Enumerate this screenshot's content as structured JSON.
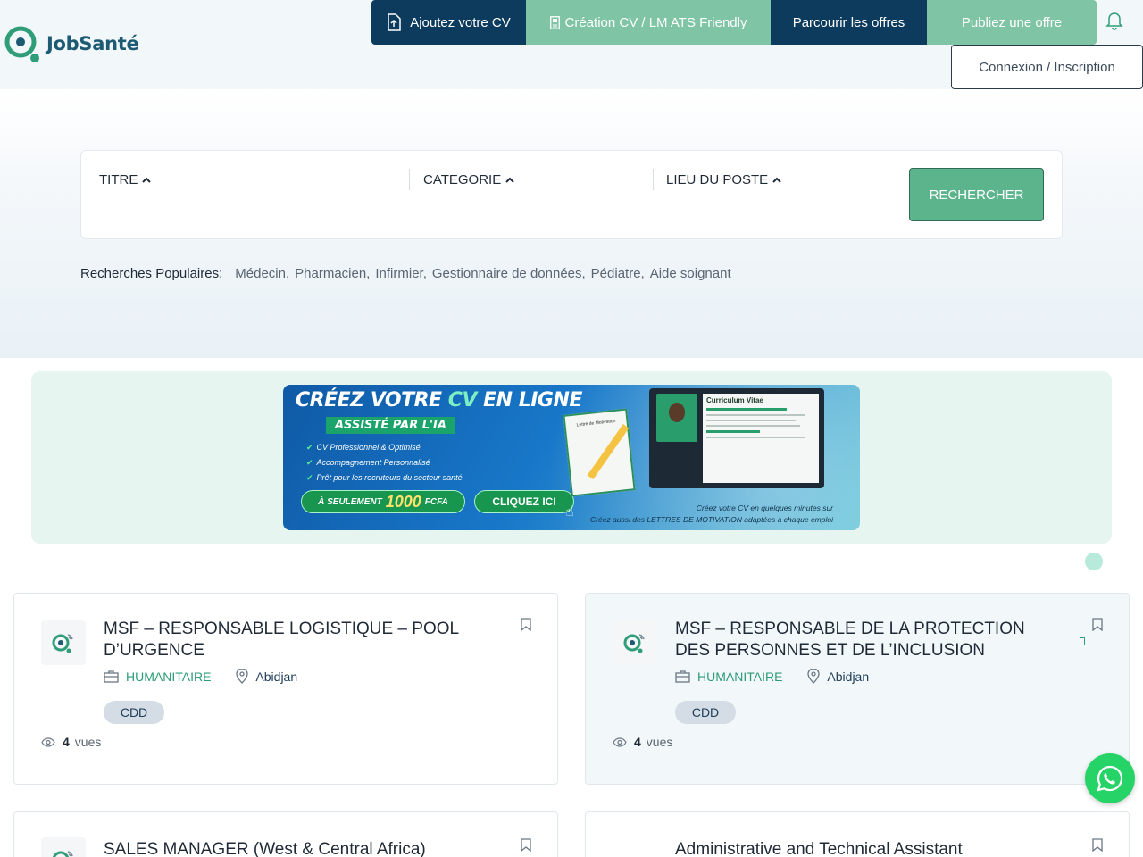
{
  "brand": {
    "name": "JobSanté",
    "accent": "#2f9e78",
    "dark": "#0d3b5e",
    "green": "#7fc4a4"
  },
  "nav": {
    "upload_cv": "Ajoutez votre CV",
    "create_cv": "Création CV / LM ATS Friendly",
    "browse_offers": "Parcourir les offres",
    "publish_offer": "Publiez une offre",
    "login": "Connexion / Inscription"
  },
  "search": {
    "title_label": "TITRE",
    "category_label": "CATEGORIE",
    "location_label": "LIEU DU POSTE",
    "button": "RECHERCHER",
    "popular_label": "Recherches Populaires:",
    "popular": [
      "Médecin,",
      "Pharmacien,",
      "Infirmier,",
      "Gestionnaire de données,",
      "Pédiatre,",
      "Aide soignant"
    ]
  },
  "banner": {
    "headline_1": "CRÉEZ VOTRE",
    "headline_cv": "CV",
    "headline_2": "EN LIGNE",
    "subheadline": "ASSISTÉ PAR L'IA",
    "bullets": [
      "CV Professionnel & Optimisé",
      "Accompagnement Personnalisé",
      "Prêt pour les recruteurs du secteur santé"
    ],
    "price_prefix": "À SEULEMENT",
    "price": "1000",
    "currency": "FCFA",
    "cta": "CLIQUEZ ICI",
    "tagline_1": "Créez votre CV en quelques minutes sur",
    "tagline_2": "Créez aussi des LETTRES DE MOTIVATION adaptées à chaque emploi",
    "doc_title": "Curriculum Vitae",
    "letter_title": "Lettre de Motivation"
  },
  "jobs": [
    {
      "title": "MSF – RESPONSABLE LOGISTIQUE – POOL D’URGENCE",
      "category": "HUMANITAIRE",
      "location": "Abidjan",
      "contract": "CDD",
      "views": "4",
      "views_label": "vues"
    },
    {
      "title": "MSF – RESPONSABLE DE LA PROTECTION DES PERSONNES ET DE L’INCLUSION",
      "category": "HUMANITAIRE",
      "location": "Abidjan",
      "contract": "CDD",
      "views": "4",
      "views_label": "vues"
    },
    {
      "title": "SALES MANAGER (West & Central Africa)"
    },
    {
      "title": "Administrative and Technical Assistant"
    }
  ]
}
